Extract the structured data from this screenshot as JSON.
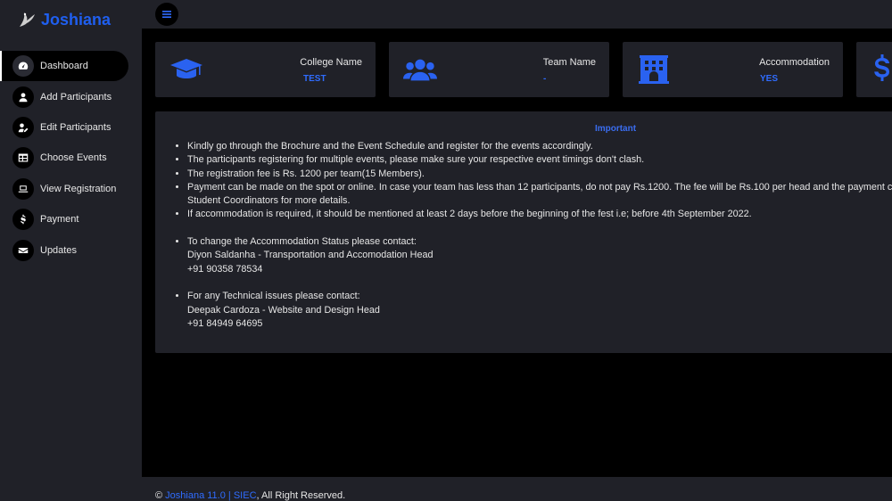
{
  "brand": {
    "name": "Joshiana",
    "logo_icon": "bird-logo-icon"
  },
  "sidebar": {
    "items": [
      {
        "label": "Dashboard",
        "icon": "gauge-icon",
        "active": true
      },
      {
        "label": "Add Participants",
        "icon": "user-icon",
        "active": false
      },
      {
        "label": "Edit Participants",
        "icon": "user-edit-icon",
        "active": false
      },
      {
        "label": "Choose Events",
        "icon": "table-icon",
        "active": false
      },
      {
        "label": "View Registration",
        "icon": "laptop-icon",
        "active": false
      },
      {
        "label": "Payment",
        "icon": "dollar-icon",
        "active": false
      },
      {
        "label": "Updates",
        "icon": "envelope-icon",
        "active": false
      }
    ]
  },
  "topbar": {
    "menu_icon": "hamburger-icon"
  },
  "cards": [
    {
      "title": "College Name",
      "value": "TEST",
      "icon": "graduation-cap-icon"
    },
    {
      "title": "Team Name",
      "value": "-",
      "icon": "users-icon"
    },
    {
      "title": "Accommodation",
      "value": "YES",
      "icon": "hotel-icon"
    },
    {
      "title": "",
      "value": "",
      "icon": "dollar-icon"
    }
  ],
  "notice": {
    "title": "Important",
    "items": [
      "Kindly go through the Brochure and the Event Schedule and register for the events accordingly.",
      "The participants registering for multiple events, please make sure your respective event timings don't clash.",
      "The registration fee is Rs. 1200 per team(15 Members).",
      "Payment can be made on the spot or online. In case your team has less than 12 participants, do not pay Rs.1200. The fee will be Rs.100 per head and the payment can b",
      "Student Coordinators for more details.",
      "If accommodation is required, it should be mentioned at least 2 days before the beginning of the fest i.e; before 4th September 2022."
    ],
    "accommodation_contact": {
      "heading": "To change the Accommodation Status please contact:",
      "name": "Diyon Saldanha - Transportation and Accomodation Head",
      "phone": "+91 90358 78534"
    },
    "technical_contact": {
      "heading": "For any Technical issues please contact:",
      "name": "Deepak Cardoza - Website and Design Head",
      "phone": "+91 84949 64695"
    }
  },
  "footer": {
    "copyright": "©",
    "product": "Joshiana 11.0",
    "separator": "|",
    "org": "SIEC",
    "suffix": ", All Right Reserved."
  },
  "colors": {
    "accent": "#2f6cff",
    "background": "#202128",
    "content": "#000000"
  }
}
